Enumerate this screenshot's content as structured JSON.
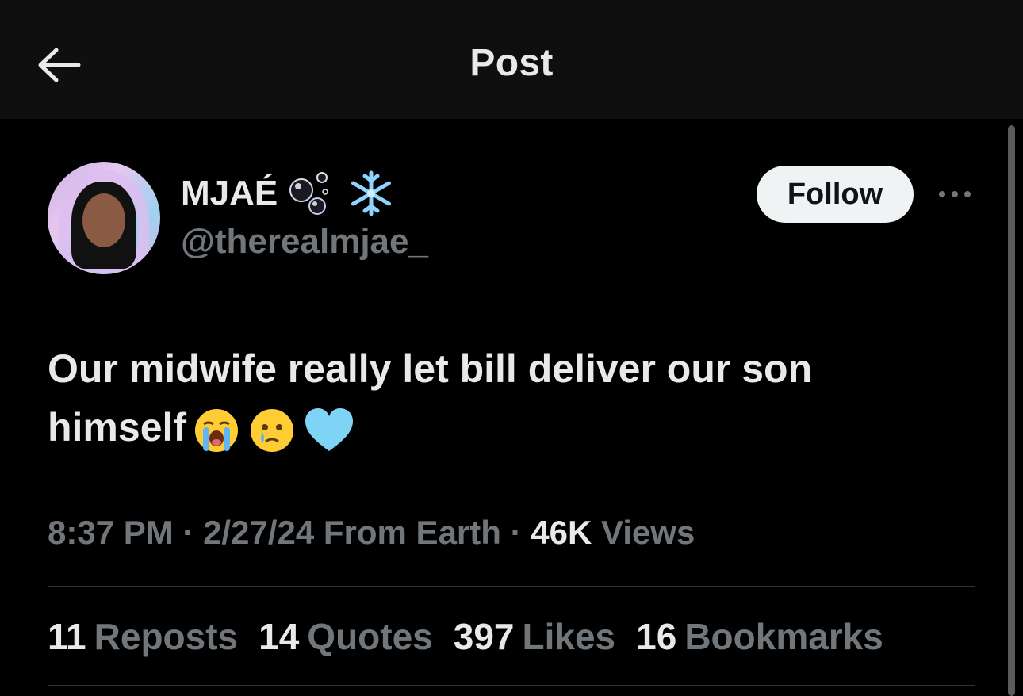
{
  "header": {
    "title": "Post"
  },
  "author": {
    "display_name": "MJAÉ",
    "name_emojis": [
      "bubbles-emoji",
      "snowflake-emoji"
    ],
    "handle": "@therealmjae_"
  },
  "actions": {
    "follow_label": "Follow"
  },
  "tweet": {
    "text_line1": "Our midwife really let bill deliver our son",
    "text_line2": "himself",
    "emojis": [
      "loudly-crying-face-emoji",
      "face-holding-back-tears-emoji",
      "light-blue-heart-emoji"
    ]
  },
  "meta": {
    "time": "8:37 PM",
    "sep1": "·",
    "date": "2/27/24",
    "source": "From Earth",
    "sep2": "·",
    "views_count": "46K",
    "views_label": "Views"
  },
  "stats": [
    {
      "count": "11",
      "label": "Reposts"
    },
    {
      "count": "14",
      "label": "Quotes"
    },
    {
      "count": "397",
      "label": "Likes"
    },
    {
      "count": "16",
      "label": "Bookmarks"
    }
  ],
  "colors": {
    "background": "#000000",
    "header_bg": "#0f0f0f",
    "text_primary": "#e7e9ea",
    "text_secondary": "#71767b",
    "follow_bg": "#eff3f4",
    "divider": "#2f3336"
  }
}
